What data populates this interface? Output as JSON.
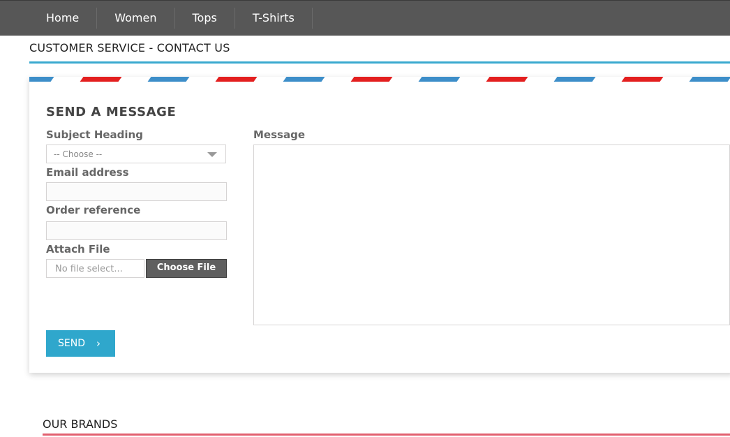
{
  "nav": {
    "items": [
      "Home",
      "Women",
      "Tops",
      "T-Shirts"
    ]
  },
  "page": {
    "heading": "CUSTOMER SERVICE - CONTACT US"
  },
  "form": {
    "title": "SEND A MESSAGE",
    "subject_label": "Subject Heading",
    "subject_value": "-- Choose --",
    "email_label": "Email address",
    "email_value": "",
    "order_label": "Order reference",
    "order_value": "",
    "attach_label": "Attach File",
    "file_status": "No file select...",
    "choose_file_label": "Choose File",
    "message_label": "Message",
    "message_value": "",
    "send_label": "SEND",
    "send_icon": "chevron-right-icon"
  },
  "footer": {
    "brands_heading": "OUR BRANDS"
  },
  "colors": {
    "topbar": "#575757",
    "accent_blue": "#3aa9cf",
    "send_button": "#2fa7cc",
    "airmail_red": "#e31f1f",
    "airmail_blue": "#3d8ec9",
    "brands_rule": "#e25f6f"
  }
}
